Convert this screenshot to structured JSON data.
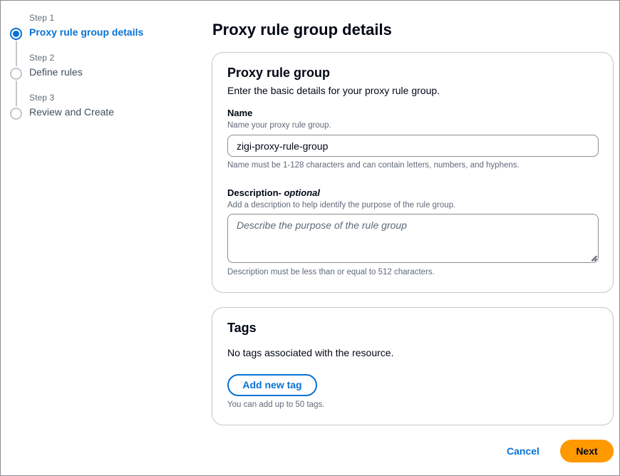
{
  "steps": [
    {
      "label": "Step 1",
      "title": "Proxy rule group details",
      "state": "active"
    },
    {
      "label": "Step 2",
      "title": "Define rules",
      "state": "pending"
    },
    {
      "label": "Step 3",
      "title": "Review and Create",
      "state": "pending"
    }
  ],
  "page": {
    "title": "Proxy rule group details"
  },
  "rule_group": {
    "title": "Proxy rule group",
    "description": "Enter the basic details for your proxy rule group.",
    "name": {
      "label": "Name",
      "sublabel": "Name your proxy rule group.",
      "value": "zigi-proxy-rule-group",
      "constraint": "Name must be 1-128 characters and can contain letters, numbers, and hyphens."
    },
    "description_field": {
      "label": "Description-",
      "optional": "optional",
      "sublabel": "Add a description to help identify the purpose of the rule group.",
      "placeholder": "Describe the purpose of the rule group",
      "constraint": "Description must be less than or equal to 512 characters."
    }
  },
  "tags": {
    "title": "Tags",
    "empty_text": "No tags associated with the resource.",
    "add_label": "Add new tag",
    "limit_text": "You can add up to 50 tags."
  },
  "footer": {
    "cancel_label": "Cancel",
    "next_label": "Next"
  },
  "colors": {
    "accent": "#0972d3",
    "primary_button": "#ff9900",
    "border": "#c6c6cd",
    "muted_text": "#5f6b7a"
  }
}
